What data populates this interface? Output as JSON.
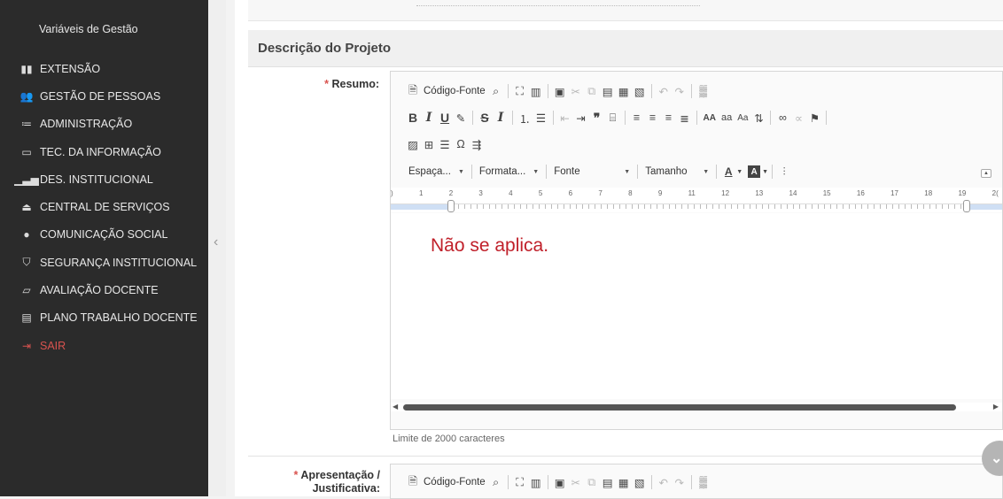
{
  "sidebar": {
    "top_item": "Variáveis de Gestão",
    "items": [
      {
        "label": "EXTENSÃO",
        "icon": "▮▮"
      },
      {
        "label": "GESTÃO DE PESSOAS",
        "icon": "👥"
      },
      {
        "label": "ADMINISTRAÇÃO",
        "icon": "≔"
      },
      {
        "label": "TEC. DA INFORMAÇÃO",
        "icon": "▭"
      },
      {
        "label": "DES. INSTITUCIONAL",
        "icon": "▁▃▅"
      },
      {
        "label": "CENTRAL DE SERVIÇOS",
        "icon": "⏏"
      },
      {
        "label": "COMUNICAÇÃO SOCIAL",
        "icon": "●"
      },
      {
        "label": "SEGURANÇA INSTITUCIONAL",
        "icon": "⛉"
      },
      {
        "label": "AVALIAÇÃO DOCENTE",
        "icon": "▱"
      },
      {
        "label": "PLANO TRABALHO DOCENTE",
        "icon": "▤"
      },
      {
        "label": "SAIR",
        "icon": "⇥"
      }
    ],
    "collapse_icon": "‹"
  },
  "section": {
    "title": "Descrição do Projeto"
  },
  "resumo": {
    "required_mark": "*",
    "label": "Resumo:",
    "toolbar": {
      "source_label": "Código-Fonte",
      "combos": [
        "Espaça...",
        "Formata...",
        "Fonte",
        "Tamanho"
      ],
      "text_color": "A",
      "bg_color": "A"
    },
    "ruler_numbers": [
      ")",
      "1",
      "2",
      "3",
      "4",
      "5",
      "6",
      "7",
      "8",
      "9",
      "11",
      "12",
      "13",
      "14",
      "15",
      "16",
      "17",
      "18",
      "19",
      "2("
    ],
    "content": "Não se aplica.",
    "limit": "Limite de 2000 caracteres"
  },
  "apresentacao": {
    "required_mark": "*",
    "label_line1": "Apresentação /",
    "label_line2": "Justificativa:",
    "toolbar": {
      "source_label": "Código-Fonte"
    }
  },
  "colors": {
    "sidebar_bg": "#2b2b2b",
    "required": "#d9534f",
    "content_text": "#c0202a"
  }
}
